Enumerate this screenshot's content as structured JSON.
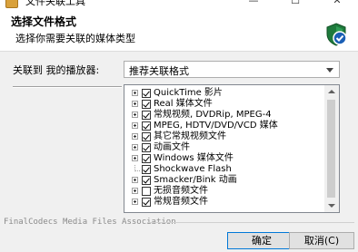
{
  "window": {
    "title": "文件关联工具"
  },
  "header": {
    "title": "选择文件格式",
    "subtitle": "选择你需要关联的媒体类型"
  },
  "association": {
    "label": "关联到 我的播放器:",
    "selected": "推荐关联格式"
  },
  "tree": {
    "items": [
      {
        "label": "QuickTime 影片",
        "checked": true,
        "expandable": true
      },
      {
        "label": "Real 媒体文件",
        "checked": true,
        "expandable": true
      },
      {
        "label": "常规视频, DVDRip, MPEG-4",
        "checked": true,
        "expandable": true
      },
      {
        "label": "MPEG, HDTV/DVD/VCD 媒体",
        "checked": true,
        "expandable": true
      },
      {
        "label": "其它常规视频文件",
        "checked": true,
        "expandable": true
      },
      {
        "label": "动画文件",
        "checked": true,
        "expandable": true
      },
      {
        "label": "Windows 媒体文件",
        "checked": true,
        "expandable": true
      },
      {
        "label": "Shockwave Flash",
        "checked": true,
        "expandable": false
      },
      {
        "label": "Smacker/Bink 动画",
        "checked": true,
        "expandable": true
      },
      {
        "label": "无损音频文件",
        "checked": false,
        "expandable": true
      },
      {
        "label": "常规音频文件",
        "checked": true,
        "expandable": true
      }
    ]
  },
  "footer": {
    "text": "FinalCodecs Media Files Association"
  },
  "buttons": {
    "ok": "确定",
    "cancel": "取消(C)"
  },
  "colors": {
    "accent": "#0078d7",
    "shield": "#1e7a3c",
    "check_circle": "#1b5fb5"
  }
}
